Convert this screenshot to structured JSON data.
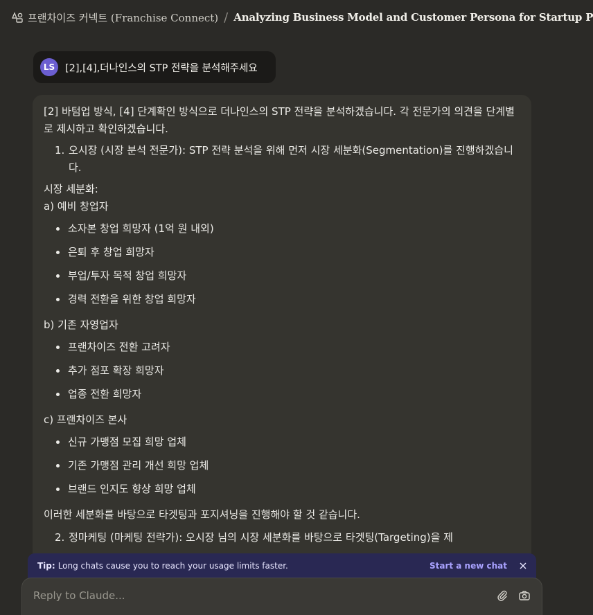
{
  "header": {
    "project_name": "프랜차이즈 커넥트 (Franchise Connect)",
    "separator": "/",
    "conversation_title": "Analyzing Business Model and Customer Persona for Startup Platform"
  },
  "user_message": {
    "avatar_initials": "LS",
    "text": "[2],[4],더나인스의 STP 전략을 분석해주세요"
  },
  "assistant": {
    "intro": "[2] 바텀업 방식, [4] 단계확인 방식으로 더나인스의 STP 전략을 분석하겠습니다. 각 전문가의 의견을 단계별로 제시하고 확인하겠습니다.",
    "step1_num": "1.",
    "step1_text": "오시장 (시장 분석 전문가): STP 전략 분석을 위해 먼저 시장 세분화(Segmentation)를 진행하겠습니다.",
    "segmentation_heading": "시장 세분화:",
    "groups": [
      {
        "label": "a) 예비 창업자",
        "items": [
          "소자본 창업 희망자 (1억 원 내외)",
          "은퇴 후 창업 희망자",
          "부업/투자 목적 창업 희망자",
          "경력 전환을 위한 창업 희망자"
        ]
      },
      {
        "label": "b) 기존 자영업자",
        "items": [
          "프랜차이즈 전환 고려자",
          "추가 점포 확장 희망자",
          "업종 전환 희망자"
        ]
      },
      {
        "label": "c) 프랜차이즈 본사",
        "items": [
          "신규 가맹점 모집 희망 업체",
          "기존 가맹점 관리 개선 희망 업체",
          "브랜드 인지도 향상 희망 업체"
        ]
      }
    ],
    "conclusion": "이러한 세분화를 바탕으로 타겟팅과 포지셔닝을 진행해야 할 것 같습니다.",
    "step2_num": "2.",
    "step2_text": "정마케팅 (마케팅 전략가): 오시장 님의 시장 세분화를 바탕으로 타겟팅(Targeting)을 제"
  },
  "tip": {
    "label": "Tip:",
    "text": "Long chats cause you to reach your usage limits faster.",
    "link": "Start a new chat"
  },
  "composer": {
    "placeholder": "Reply to Claude..."
  },
  "icons": {
    "project": "project-icon",
    "chevron": "chevron-down-icon",
    "close": "close-icon",
    "attach": "paperclip-icon",
    "camera": "camera-icon"
  },
  "colors": {
    "background": "#2b2a27",
    "assistant_bubble": "#35342f",
    "user_bubble": "#1b1a18",
    "avatar": "#6b5ed0",
    "tip_bar": "#292853",
    "tip_link": "#a9a2ff"
  }
}
